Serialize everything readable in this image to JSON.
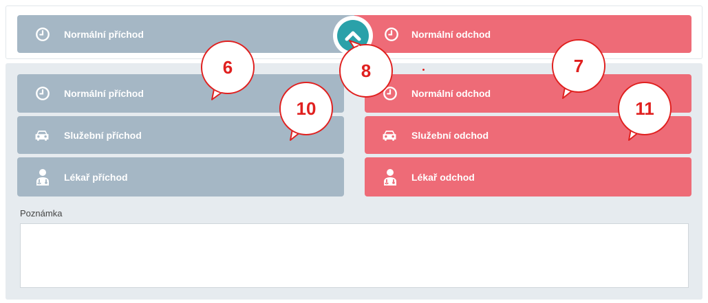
{
  "colors": {
    "arrival": "#a5b7c5",
    "departure": "#ee6b77",
    "toggle": "#2aa1a9",
    "callout_text": "#e0201f"
  },
  "top_row": {
    "arrival_label": "Normální příchod",
    "departure_label": "Normální odchod",
    "arrival_icon": "clock-icon",
    "departure_icon": "clock-icon",
    "toggle_icon": "chevron-up-icon"
  },
  "arrival_buttons": [
    {
      "label": "Normální příchod",
      "icon": "clock-icon"
    },
    {
      "label": "Služební příchod",
      "icon": "car-icon"
    },
    {
      "label": "Lékař příchod",
      "icon": "doctor-icon"
    }
  ],
  "departure_buttons": [
    {
      "label": "Normální odchod",
      "icon": "clock-icon"
    },
    {
      "label": "Služební odchod",
      "icon": "car-icon"
    },
    {
      "label": "Lékař odchod",
      "icon": "doctor-icon"
    }
  ],
  "note": {
    "label": "Poznámka",
    "value": ""
  },
  "callouts": [
    "6",
    "7",
    "8",
    "10",
    "11"
  ]
}
